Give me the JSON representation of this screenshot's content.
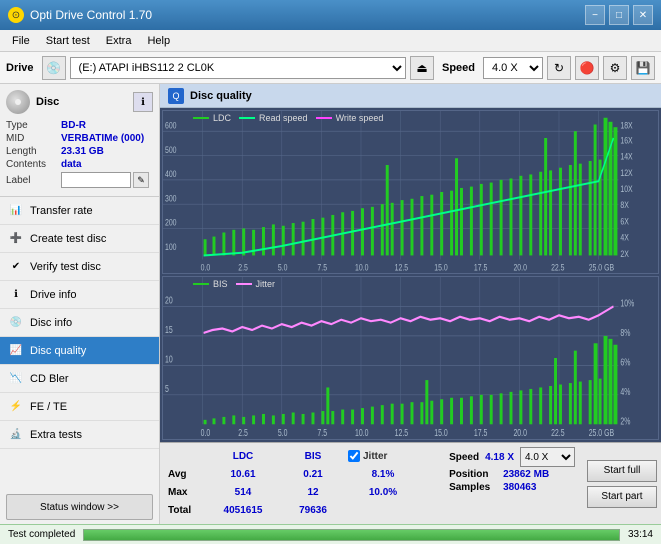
{
  "window": {
    "title": "Opti Drive Control 1.70",
    "icon": "⊙"
  },
  "titlebar": {
    "minimize": "−",
    "maximize": "□",
    "close": "✕"
  },
  "menu": {
    "items": [
      "File",
      "Start test",
      "Extra",
      "Help"
    ]
  },
  "drive_toolbar": {
    "drive_label": "Drive",
    "drive_value": "(E:) ATAPI iHBS112  2 CL0K",
    "speed_label": "Speed",
    "speed_value": "4.0 X"
  },
  "disc_panel": {
    "title": "Disc",
    "type_label": "Type",
    "type_value": "BD-R",
    "mid_label": "MID",
    "mid_value": "VERBATIMe (000)",
    "length_label": "Length",
    "length_value": "23.31 GB",
    "contents_label": "Contents",
    "contents_value": "data",
    "label_label": "Label",
    "label_placeholder": ""
  },
  "nav": {
    "items": [
      {
        "label": "Transfer rate",
        "active": false
      },
      {
        "label": "Create test disc",
        "active": false
      },
      {
        "label": "Verify test disc",
        "active": false
      },
      {
        "label": "Drive info",
        "active": false
      },
      {
        "label": "Disc info",
        "active": false
      },
      {
        "label": "Disc quality",
        "active": true
      },
      {
        "label": "CD Bler",
        "active": false
      },
      {
        "label": "FE / TE",
        "active": false
      },
      {
        "label": "Extra tests",
        "active": false
      }
    ],
    "status_window_btn": "Status window >>"
  },
  "chart": {
    "title": "Disc quality",
    "legend": {
      "ldc_label": "LDC",
      "ldc_color": "#22cc22",
      "read_label": "Read speed",
      "read_color": "#00ff00",
      "write_label": "Write speed",
      "write_color": "#ff44ff",
      "bis_label": "BIS",
      "bis_color": "#22cc22",
      "jitter_label": "Jitter",
      "jitter_color": "#ff88ff"
    },
    "top_y_labels": [
      "600",
      "500",
      "400",
      "300",
      "200",
      "100"
    ],
    "top_y_right": [
      "18X",
      "16X",
      "14X",
      "12X",
      "10X",
      "8X",
      "6X",
      "4X",
      "2X"
    ],
    "bottom_y_labels": [
      "20",
      "15",
      "10",
      "5"
    ],
    "bottom_y_right": [
      "10%",
      "8%",
      "6%",
      "4%",
      "2%"
    ],
    "x_labels": [
      "0.0",
      "2.5",
      "5.0",
      "7.5",
      "10.0",
      "12.5",
      "15.0",
      "17.5",
      "20.0",
      "22.5",
      "25.0 GB"
    ]
  },
  "stats": {
    "ldc_header": "LDC",
    "bis_header": "BIS",
    "jitter_header": "Jitter",
    "speed_header": "Speed",
    "avg_label": "Avg",
    "max_label": "Max",
    "total_label": "Total",
    "ldc_avg": "10.61",
    "ldc_max": "514",
    "ldc_total": "4051615",
    "bis_avg": "0.21",
    "bis_max": "12",
    "bis_total": "79636",
    "jitter_avg": "8.1%",
    "jitter_max": "10.0%",
    "speed_val": "4.18 X",
    "speed_select": "4.0 X",
    "position_label": "Position",
    "position_val": "23862 MB",
    "samples_label": "Samples",
    "samples_val": "380463",
    "jitter_checked": true
  },
  "buttons": {
    "start_full": "Start full",
    "start_part": "Start part"
  },
  "statusbar": {
    "text": "Test completed",
    "progress": 100,
    "time": "33:14"
  }
}
